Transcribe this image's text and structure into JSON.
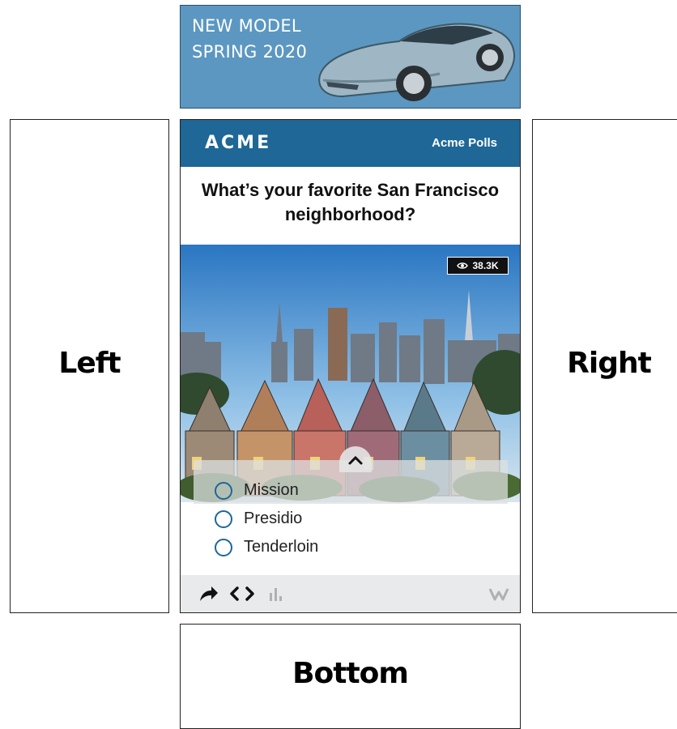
{
  "ad": {
    "line1": "NEW MODEL",
    "line2": "SPRING 2020"
  },
  "placements": {
    "left": "Left",
    "right": "Right",
    "bottom": "Bottom"
  },
  "widget": {
    "brand": "ACME",
    "header_link": "Acme Polls",
    "question": "What’s your favorite San Francisco neighborhood?",
    "views": "38.3K",
    "options": [
      {
        "label": "Mission"
      },
      {
        "label": "Presidio"
      },
      {
        "label": "Tenderloin"
      }
    ],
    "footer_icons": [
      "share-icon",
      "embed-icon",
      "results-icon",
      "brand-w-icon"
    ]
  },
  "colors": {
    "header": "#1e6796",
    "ad_bg": "#5b97c1",
    "radio": "#1e6796",
    "footer_bg": "#e9eaeb"
  }
}
